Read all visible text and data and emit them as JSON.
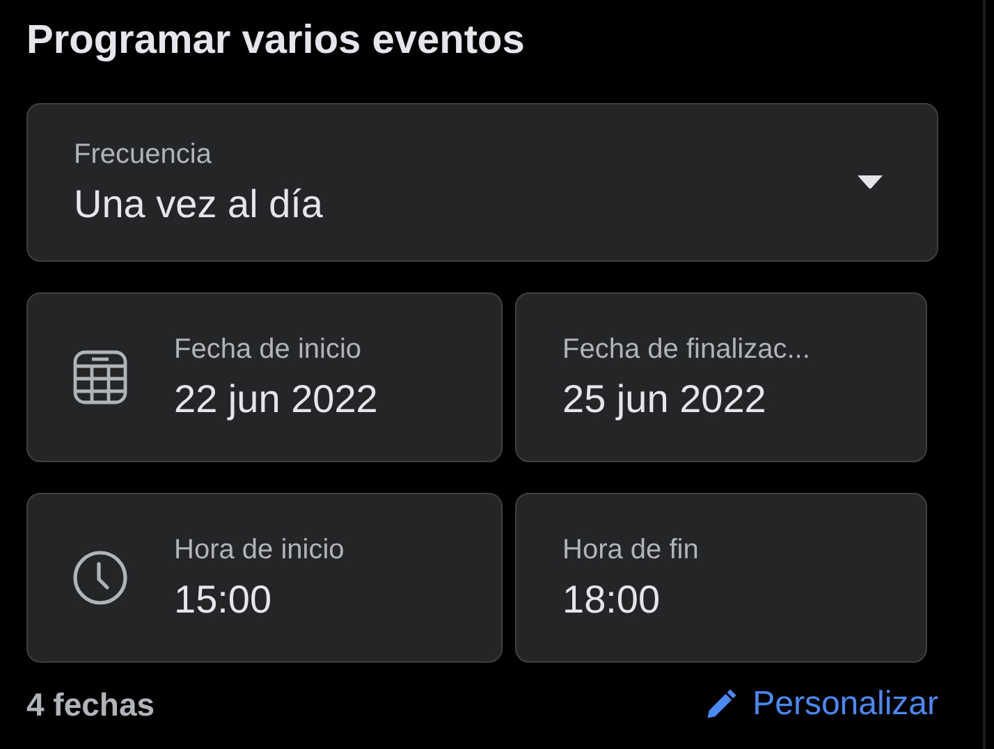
{
  "title": "Programar varios eventos",
  "frequency": {
    "label": "Frecuencia",
    "value": "Una vez al día"
  },
  "ranges": [
    {
      "kind": "date",
      "start": {
        "label": "Fecha de inicio",
        "value": "22 jun 2022"
      },
      "end": {
        "label": "Fecha de finalizac...",
        "value": "25 jun 2022"
      }
    },
    {
      "kind": "time",
      "start": {
        "label": "Hora de inicio",
        "value": "15:00"
      },
      "end": {
        "label": "Hora de fin",
        "value": "18:00"
      }
    }
  ],
  "footer": {
    "count": "4 fechas",
    "action": "Personalizar"
  }
}
